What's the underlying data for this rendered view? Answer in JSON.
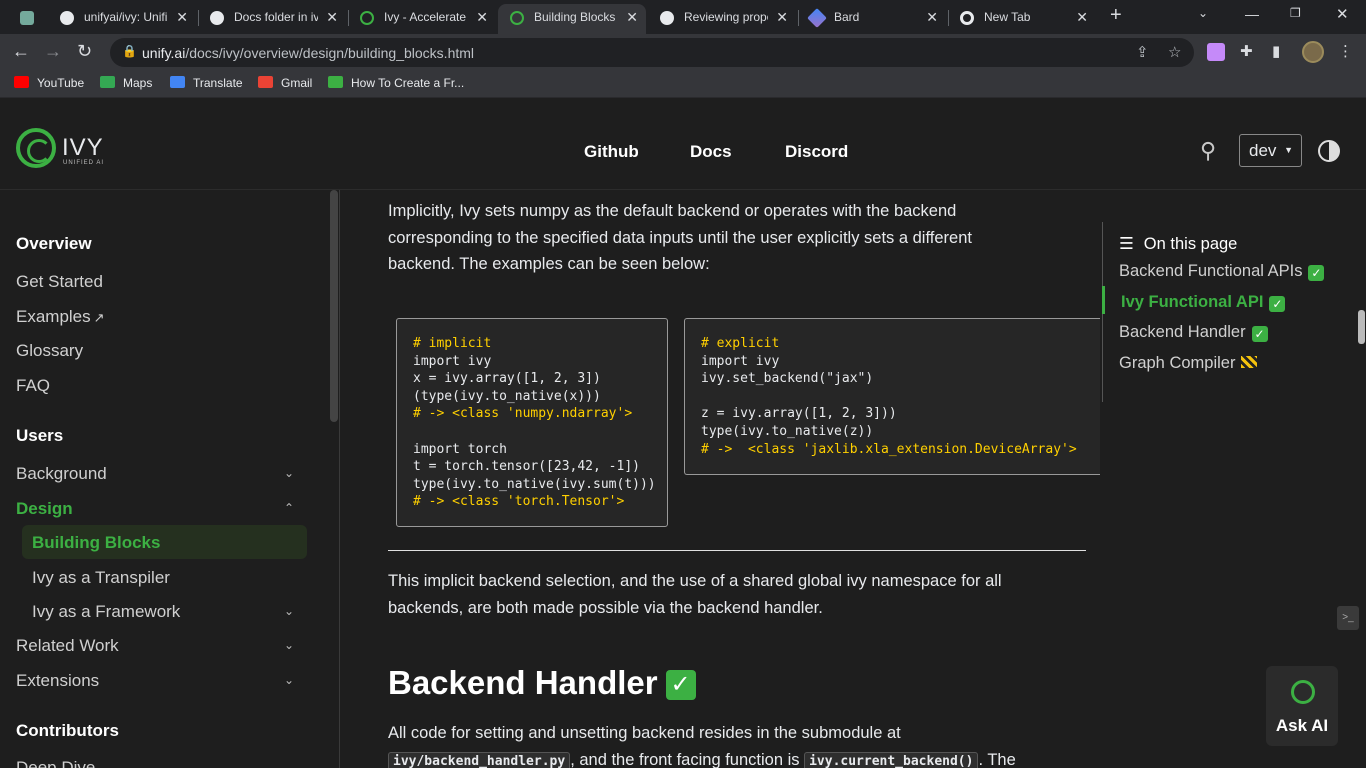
{
  "browser": {
    "tabs": [
      {
        "title": "unifyai/ivy: Unifi",
        "favicon": "github-icon"
      },
      {
        "title": "Docs folder in iv",
        "favicon": "github-color-icon"
      },
      {
        "title": "Ivy - Accelerate",
        "favicon": "ivy-icon"
      },
      {
        "title": "Building Blocks",
        "favicon": "ivy-icon",
        "active": true
      },
      {
        "title": "Reviewing propo",
        "favicon": "github-icon"
      },
      {
        "title": "Bard",
        "favicon": "bard-icon"
      },
      {
        "title": "New Tab",
        "favicon": "chrome-icon"
      }
    ],
    "new_tab_symbol": "+",
    "url_domain": "unify.ai",
    "url_path": "/docs/ivy/overview/design/building_blocks.html",
    "bookmarks": [
      {
        "label": "YouTube",
        "color": "#ff0000"
      },
      {
        "label": "Maps",
        "color": "#34a853"
      },
      {
        "label": "Translate",
        "color": "#4285f4"
      },
      {
        "label": "Gmail",
        "color": "#ea4335"
      },
      {
        "label": "How To Create a Fr...",
        "color": "#3cb043"
      }
    ]
  },
  "site": {
    "brand": "IVY",
    "brand_sub": "UNIFIED AI",
    "nav": [
      "Github",
      "Docs",
      "Discord"
    ],
    "version": "dev",
    "accent": "#3cb043"
  },
  "sidebar": {
    "sections": [
      {
        "label": "Overview"
      },
      {
        "label": "Users"
      },
      {
        "label": "Contributors"
      }
    ],
    "items": {
      "get_started": "Get Started",
      "examples": "Examples",
      "glossary": "Glossary",
      "faq": "FAQ",
      "background": "Background",
      "design": "Design",
      "building_blocks": "Building Blocks",
      "transpiler": "Ivy as a Transpiler",
      "framework": "Ivy as a Framework",
      "related_work": "Related Work",
      "extensions": "Extensions",
      "deep_dive": "Deep Dive"
    }
  },
  "content": {
    "intro": "Implicitly, Ivy sets numpy as the default backend or operates with the backend corresponding to the specified data inputs until the user explicitly sets a different backend. The examples can be seen below:",
    "code_implicit": [
      "# implicit",
      "import ivy",
      "x = ivy.array([1, 2, 3])",
      "(type(ivy.to_native(x)))",
      "# -> <class 'numpy.ndarray'>",
      "",
      "import torch",
      "t = torch.tensor([23,42, -1])",
      "type(ivy.to_native(ivy.sum(t)))",
      "# -> <class 'torch.Tensor'>"
    ],
    "code_explicit": [
      "# explicit",
      "import ivy",
      "ivy.set_backend(\"jax\")",
      "",
      "z = ivy.array([1, 2, 3]))",
      "type(ivy.to_native(z))",
      "# ->  <class 'jaxlib.xla_extension.DeviceArray'>"
    ],
    "para2": "This implicit backend selection, and the use of a shared global ivy namespace for all backends, are both made possible via the backend handler.",
    "heading": "Backend Handler",
    "heading_emoji": "✅",
    "para3_a": "All code for setting and unsetting backend resides in the submodule at",
    "para3_code1": "ivy/backend_handler.py",
    "para3_b": ", and the front facing function is",
    "para3_code2": "ivy.current_backend()",
    "para3_c": ". The"
  },
  "toc": {
    "title": "On this page",
    "items": [
      {
        "label": "Backend Functional APIs",
        "emoji": "✅"
      },
      {
        "label": "Ivy Functional API",
        "emoji": "✅",
        "active": true
      },
      {
        "label": "Backend Handler",
        "emoji": "✅"
      },
      {
        "label": "Graph Compiler",
        "emoji": "🚧"
      }
    ]
  },
  "ask_ai": "Ask AI"
}
